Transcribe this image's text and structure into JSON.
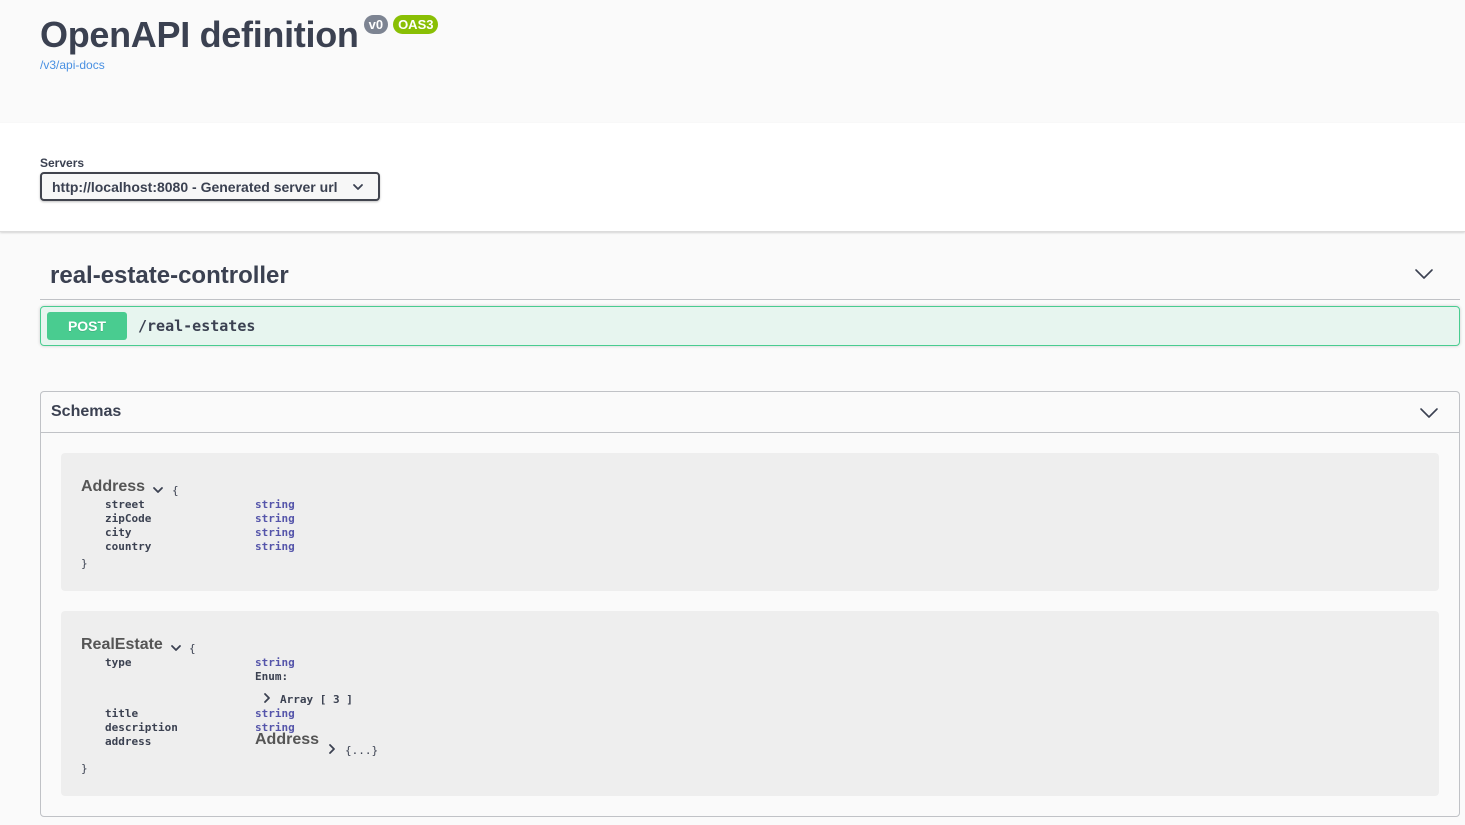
{
  "info": {
    "title": "OpenAPI definition",
    "version": "v0",
    "oas_badge": "OAS3",
    "spec_url": "/v3/api-docs"
  },
  "servers": {
    "label": "Servers",
    "selected": "http://localhost:8080 - Generated server url"
  },
  "tag": {
    "name": "real-estate-controller",
    "operations": [
      {
        "method": "POST",
        "path": "/real-estates"
      }
    ]
  },
  "schemas": {
    "title": "Schemas",
    "address": {
      "name": "Address",
      "open_brace": "{",
      "close_brace": "}",
      "properties": [
        {
          "name": "street",
          "type": "string"
        },
        {
          "name": "zipCode",
          "type": "string"
        },
        {
          "name": "city",
          "type": "string"
        },
        {
          "name": "country",
          "type": "string"
        }
      ]
    },
    "real_estate": {
      "name": "RealEstate",
      "open_brace": "{",
      "close_brace": "}",
      "type_prop": {
        "name": "type",
        "type": "string",
        "enum_label": "Enum:",
        "array_label": "Array [ 3 ]"
      },
      "title_prop": {
        "name": "title",
        "type": "string"
      },
      "description_prop": {
        "name": "description",
        "type": "string"
      },
      "address_prop": {
        "name": "address",
        "ref_name": "Address",
        "collapsed": "{...}"
      }
    }
  },
  "colors": {
    "post": "#49cc90",
    "oas": "#89bf04",
    "version": "#7d8492",
    "link": "#4990e2",
    "type": "#5555aa"
  }
}
